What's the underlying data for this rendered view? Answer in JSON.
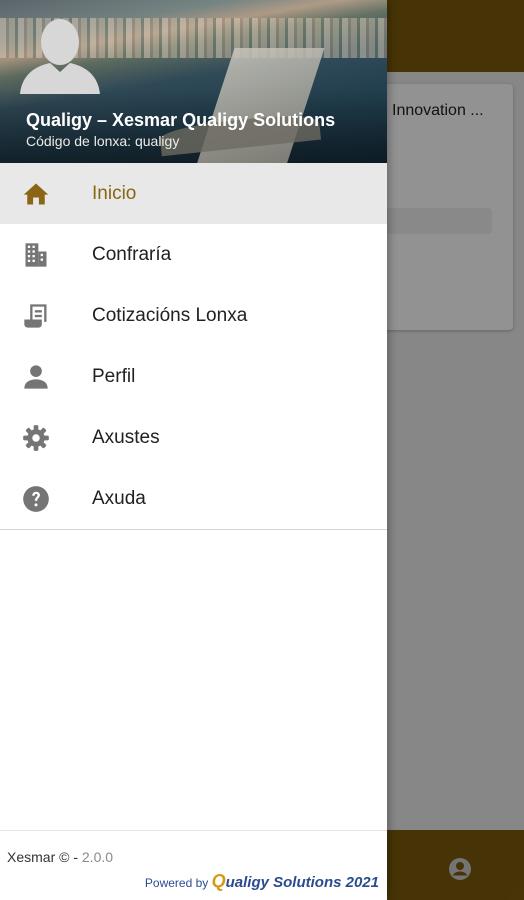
{
  "background": {
    "card_title": "Innovation ...",
    "accent_color": "#7a5a0c"
  },
  "drawer": {
    "header": {
      "title": "Qualigy – Xesmar Qualigy Solutions",
      "subtitle": "Código de lonxa: qualigy",
      "avatar_icon": "person-avatar-icon"
    },
    "menu": [
      {
        "label": "Inicio",
        "icon": "home-icon",
        "active": true
      },
      {
        "label": "Confraría",
        "icon": "building-icon",
        "active": false
      },
      {
        "label": "Cotizacións Lonxa",
        "icon": "receipt-icon",
        "active": false
      },
      {
        "label": "Perfil",
        "icon": "person-icon",
        "active": false
      },
      {
        "label": "Axustes",
        "icon": "gear-icon",
        "active": false
      },
      {
        "label": "Axuda",
        "icon": "help-icon",
        "active": false
      }
    ],
    "footer": {
      "app_name": "Xesmar © - ",
      "version": "2.0.0",
      "powered_by": "Powered by ",
      "brand_q": "Q",
      "brand_rest": "ualigy Solutions 2021"
    }
  },
  "colors": {
    "active_label": "#8a6515",
    "active_bg": "#e8e8e8",
    "icon_gray": "#757575",
    "brand_blue": "#2a4c8f",
    "brand_gold": "#d39b16"
  }
}
